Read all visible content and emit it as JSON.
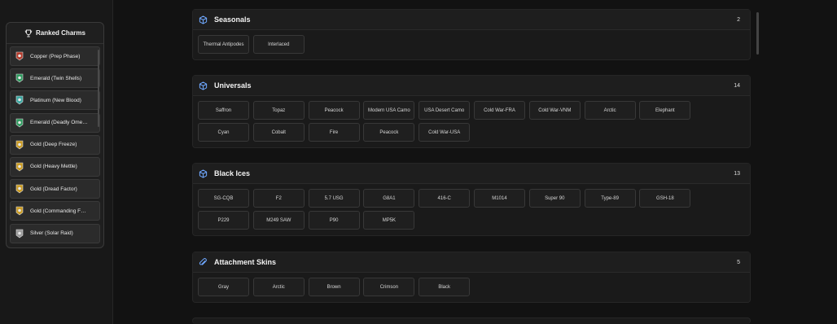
{
  "sidebar": {
    "title": "Ranked Charms",
    "items": [
      {
        "label": "Copper (Prep Phase)",
        "color": "#b23a2a"
      },
      {
        "label": "Emerald (Twin Shells)",
        "color": "#2e9a5e"
      },
      {
        "label": "Platinum (New Blood)",
        "color": "#3aa6a0"
      },
      {
        "label": "Emerald (Deadly Ome…",
        "color": "#2e9a5e"
      },
      {
        "label": "Gold (Deep Freeze)",
        "color": "#c99a22"
      },
      {
        "label": "Gold (Heavy Mettle)",
        "color": "#c99a22"
      },
      {
        "label": "Gold (Dread Factor)",
        "color": "#c99a22"
      },
      {
        "label": "Gold (Commanding F…",
        "color": "#c99a22"
      },
      {
        "label": "Silver (Solar Raid)",
        "color": "#9a9a9a"
      }
    ]
  },
  "sections": [
    {
      "title": "Seasonals",
      "count": "2",
      "icon": "cube-icon",
      "items": [
        "Thermal Antipodes",
        "Interlaced"
      ]
    },
    {
      "title": "Universals",
      "count": "14",
      "icon": "cube-icon",
      "items": [
        "Saffron",
        "Topaz",
        "Peacock",
        "Modern USA Camo",
        "USA Desert Camo",
        "Cold War-FRA",
        "Cold War-VNM",
        "Arctic",
        "Elephant",
        "Cyan",
        "Cobalt",
        "Fire",
        "Peacock",
        "Cold War-USA"
      ]
    },
    {
      "title": "Black Ices",
      "count": "13",
      "icon": "cube-icon",
      "items": [
        "SG-CQB",
        "F2",
        "5.7 USG",
        "G8A1",
        "416-C",
        "M1014",
        "Super 90",
        "Type-89",
        "GSH-18",
        "P229",
        "M249 SAW",
        "P90",
        "MP5K"
      ]
    },
    {
      "title": "Attachment Skins",
      "count": "5",
      "icon": "paperclip-icon",
      "items": [
        "Gray",
        "Arctic",
        "Brown",
        "Crimson",
        "Black"
      ]
    }
  ],
  "colors": {
    "accent": "#6fa8ff"
  }
}
